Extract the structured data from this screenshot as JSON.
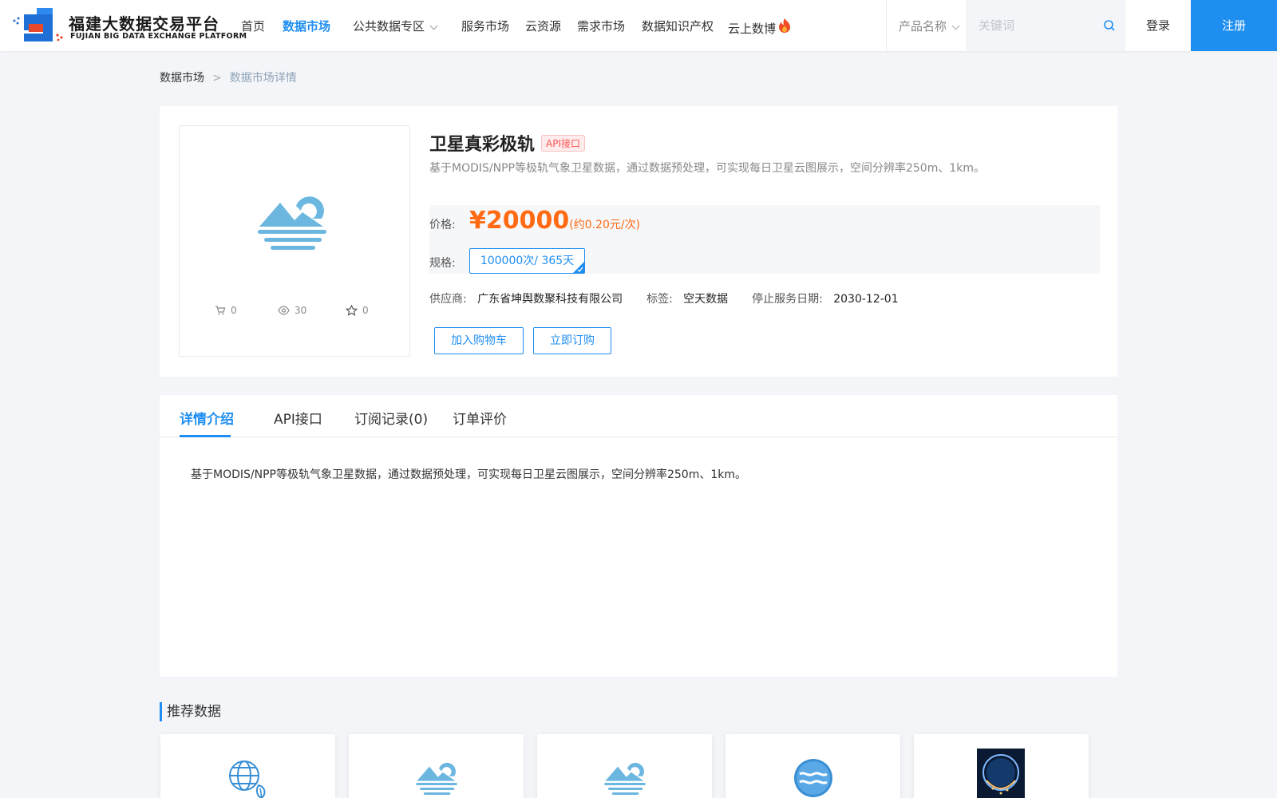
{
  "header": {
    "logo_cn": "福建大数据交易平台",
    "logo_en": "FUJIAN BIG DATA EXCHANGE  PLATFORM",
    "nav": [
      {
        "label": "首页",
        "active": false
      },
      {
        "label": "数据市场",
        "active": true
      },
      {
        "label": "公共数据专区",
        "active": false,
        "has_dropdown": true
      },
      {
        "label": "服务市场",
        "active": false
      },
      {
        "label": "云资源",
        "active": false
      },
      {
        "label": "需求市场",
        "active": false
      },
      {
        "label": "数据知识产权",
        "active": false
      },
      {
        "label": "云上数博",
        "active": false,
        "icon": "fire-icon"
      }
    ],
    "product_select": "产品名称",
    "search_placeholder": "关键词",
    "login": "登录",
    "register": "注册"
  },
  "breadcrumb": {
    "parent": "数据市场",
    "separator": ">",
    "current": "数据市场详情"
  },
  "product": {
    "title": "卫星真彩极轨",
    "tag": "API接口",
    "description": "基于MODIS/NPP等极轨气象卫星数据，通过数据预处理，可实现每日卫星云图展示，空间分辨率250m、1km。",
    "stats": {
      "cart": "0",
      "views": "30",
      "favorites": "0"
    },
    "price_label": "价格:",
    "price": "¥20000",
    "price_note": "(约0.20元/次)",
    "spec_label": "规格:",
    "spec": "100000次/ 365天",
    "supplier_label": "供应商:",
    "supplier": "广东省坤舆数聚科技有限公司",
    "tag_label": "标签:",
    "tag_value": "空天数据",
    "end_date_label": "停止服务日期:",
    "end_date": "2030-12-01",
    "add_to_cart": "加入购物车",
    "subscribe": "立即订购"
  },
  "tabs": [
    {
      "label": "详情介绍",
      "active": true
    },
    {
      "label": "API接口",
      "active": false
    },
    {
      "label": "订阅记录(0)",
      "active": false
    },
    {
      "label": "订单评价",
      "active": false
    }
  ],
  "detail_text": "基于MODIS/NPP等极轨气象卫星数据，通过数据预处理，可实现每日卫星云图展示，空间分辨率250m、1km。",
  "recommended": {
    "title": "推荐数据",
    "cards": [
      {
        "icon": "globe-leaf-icon"
      },
      {
        "icon": "image-placeholder-icon"
      },
      {
        "icon": "image-placeholder-icon"
      },
      {
        "icon": "water-wave-icon"
      },
      {
        "icon": "earth-photo-icon"
      }
    ]
  },
  "colors": {
    "brand": "#1f8ef1",
    "price": "#ff6a13",
    "tag_red": "#ff5555"
  }
}
